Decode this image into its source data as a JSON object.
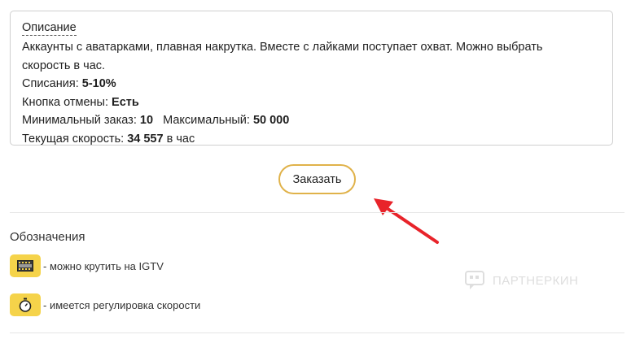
{
  "description": {
    "title": "Описание",
    "text": "Аккаунты с аватарками, плавная накрутка. Вместе с лайками поступает охват. Можно выбрать скорость в час.",
    "writeoffs_label": "Списания:",
    "writeoffs_value": "5-10%",
    "cancel_label": "Кнопка отмены:",
    "cancel_value": "Есть",
    "min_label": "Минимальный заказ:",
    "min_value": "10",
    "max_label": "Максимальный:",
    "max_value": "50 000",
    "speed_label": "Текущая скорость:",
    "speed_value": "34 557",
    "speed_unit": "в час"
  },
  "order_button": {
    "label": "Заказать"
  },
  "legend": {
    "title": "Обозначения",
    "items": [
      {
        "icon": "film-icon",
        "text": "- можно крутить на IGTV"
      },
      {
        "icon": "stopwatch-icon",
        "text": "- имеется регулировка скорости"
      }
    ]
  },
  "watermark": {
    "text": "ПАРТНЕРКИН"
  },
  "colors": {
    "accent": "#e0b24a",
    "badge": "#f5d34a",
    "arrow": "#e8232a"
  }
}
